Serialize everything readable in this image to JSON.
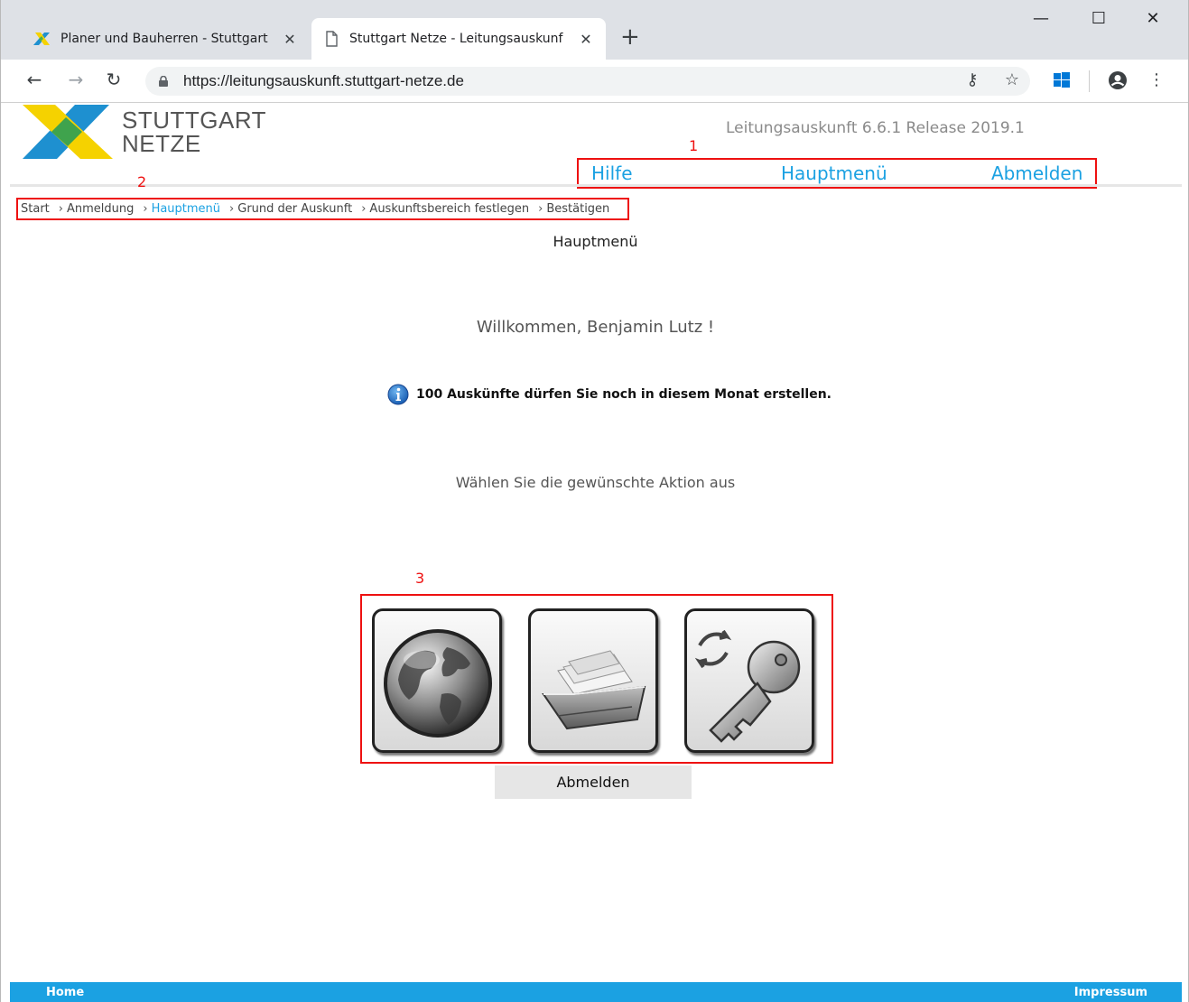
{
  "browser": {
    "tabs": [
      {
        "title": "Planer und Bauherren - Stuttgart",
        "active": false
      },
      {
        "title": "Stuttgart Netze - Leitungsauskunf",
        "active": true
      }
    ],
    "url": "https://leitungsauskunft.stuttgart-netze.de"
  },
  "header": {
    "brand_line1": "STUTTGART",
    "brand_line2": "NETZE",
    "release": "Leitungsauskunft 6.6.1 Release 2019.1",
    "nav": {
      "help": "Hilfe",
      "main_menu": "Hauptmenü",
      "logout": "Abmelden"
    }
  },
  "annotations": {
    "nav": "1",
    "breadcrumb": "2",
    "actions": "3"
  },
  "breadcrumb": [
    "Start",
    "Anmeldung",
    "Hauptmenü",
    "Grund der Auskunft",
    "Auskunftsbereich festlegen",
    "Bestätigen"
  ],
  "main": {
    "title": "Hauptmenü",
    "welcome": "Willkommen, Benjamin Lutz !",
    "info": "100 Auskünfte dürfen Sie noch in diesem Monat erstellen.",
    "prompt": "Wählen Sie die gewünschte Aktion aus",
    "actions": [
      {
        "icon": "globe-icon"
      },
      {
        "icon": "file-tray-icon"
      },
      {
        "icon": "key-change-icon"
      }
    ],
    "logout_button": "Abmelden"
  },
  "footer": {
    "home": "Home",
    "imprint": "Impressum"
  },
  "colors": {
    "accent": "#1ba1e2",
    "annotation": "#e11111"
  }
}
